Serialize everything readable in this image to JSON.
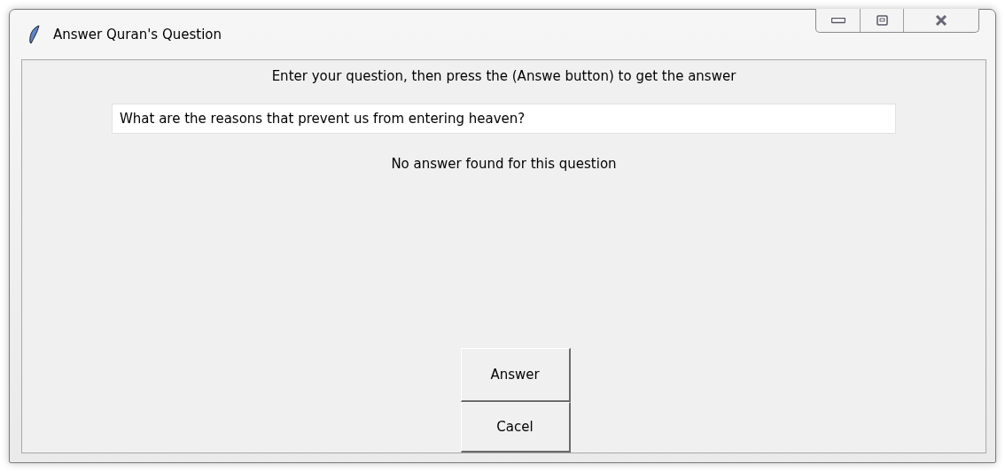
{
  "window": {
    "title": "Answer Quran's Question"
  },
  "prompt": "Enter your question, then press the (Answe button) to get the answer",
  "question_field": {
    "value": "What are the reasons that prevent us from entering heaven?"
  },
  "result": "No answer found for this question",
  "buttons": [
    {
      "label": "Answer"
    },
    {
      "label": "Cacel"
    }
  ]
}
